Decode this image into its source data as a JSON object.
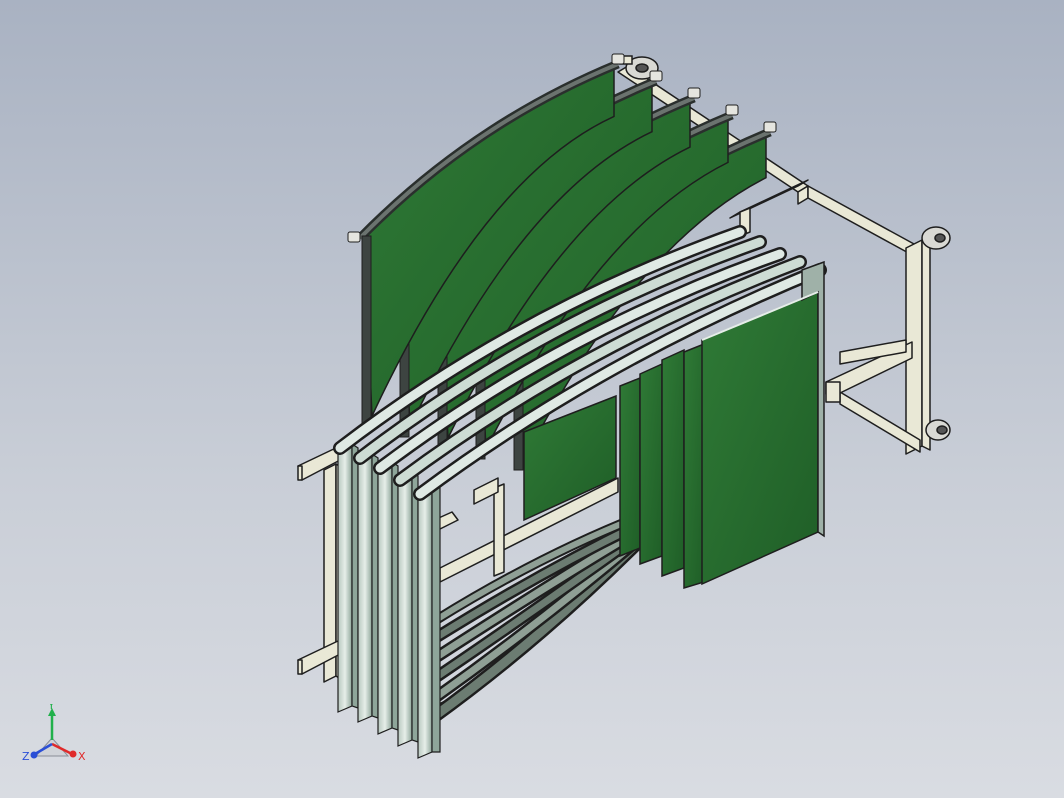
{
  "viewport": {
    "background_top": "#a9b2c2",
    "background_bottom": "#d9dce2"
  },
  "model": {
    "panel_color": "#236b2c",
    "frame_color": "#e9e8d6",
    "edge_color": "#1e1e1e",
    "rail_color": "#9fb1a8",
    "hanging_panels": 5,
    "stored_panels": 5,
    "casters": 3
  },
  "triad": {
    "x_label": "X",
    "y_label": "Y",
    "z_label": "Z",
    "x_color": "#e02a2a",
    "y_color": "#21b04b",
    "z_color": "#2b4fd6"
  }
}
